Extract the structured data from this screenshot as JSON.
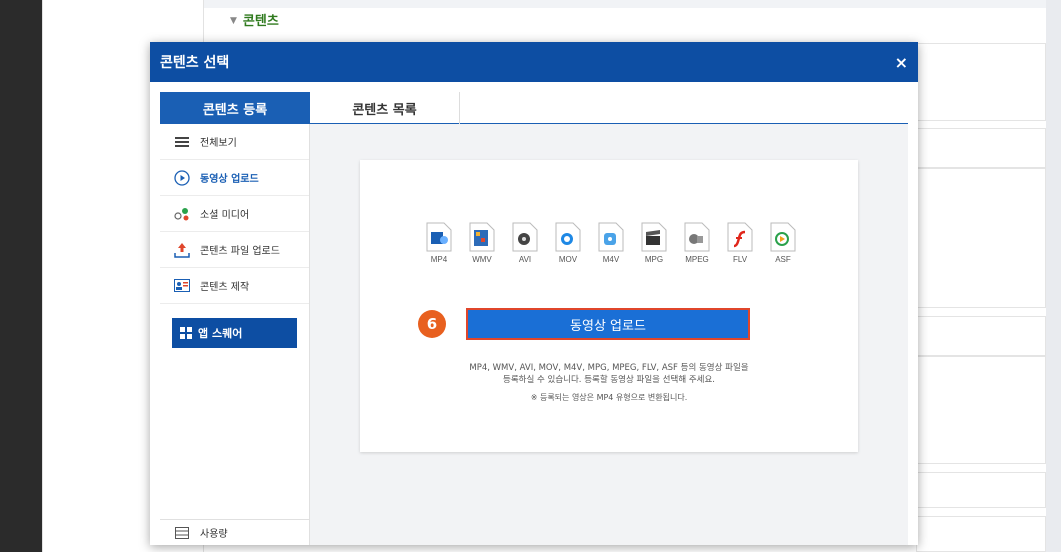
{
  "background": {
    "section_title": "콘텐츠",
    "section_arrow": "▼"
  },
  "modal": {
    "title": "콘텐츠 선택",
    "close": "×",
    "tabs": [
      {
        "label": "콘텐츠 등록",
        "active": true
      },
      {
        "label": "콘텐츠 목록",
        "active": false
      }
    ],
    "sidebar": {
      "items": [
        {
          "label": "전체보기",
          "icon": "list-icon"
        },
        {
          "label": "동영상 업로드",
          "icon": "play-circle-icon",
          "active": true
        },
        {
          "label": "소셜 미디어",
          "icon": "social-icon"
        },
        {
          "label": "콘텐츠 파일 업로드",
          "icon": "file-upload-icon"
        },
        {
          "label": "콘텐츠 제작",
          "icon": "create-icon"
        }
      ],
      "app_square": "앱 스퀘어",
      "usage": "사용량"
    },
    "upload": {
      "formats": [
        "MP4",
        "WMV",
        "AVI",
        "MOV",
        "M4V",
        "MPG",
        "MPEG",
        "FLV",
        "ASF"
      ],
      "step_number": "6",
      "button_label": "동영상 업로드",
      "description_line1": "MP4, WMV, AVI, MOV, M4V, MPG, MPEG, FLV, ASF 등의 동영상 파일을",
      "description_line2": "등록하실 수 있습니다. 등록할 동영상 파일을 선택해 주세요.",
      "note": "※ 등록되는 영상은 MP4 유형으로 변환됩니다."
    }
  },
  "colors": {
    "header": "#0d4ea3",
    "tab_active": "#1a5fb4",
    "button": "#1a6fd6",
    "button_border": "#e0462b",
    "badge": "#e8601f",
    "section_title": "#2f7a1e"
  }
}
